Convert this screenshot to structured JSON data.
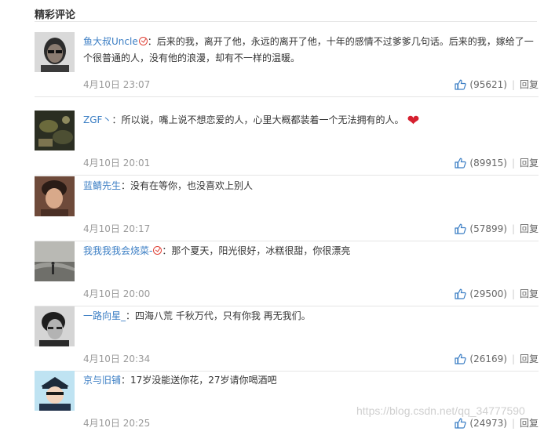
{
  "section": {
    "title": "精彩评论"
  },
  "comments": [
    {
      "user": "鱼大叔Uncle",
      "verified": true,
      "text": "：后来的我，离开了他，永远的离开了他，十年的感情不过爹爹几句话。后来的我，嫁给了一个很普通的人，没有他的浪漫，却有不一样的温暖。",
      "time": "4月10日 23:07",
      "likes": "(95621)",
      "reply": "回复"
    },
    {
      "user": "ZGF丶",
      "verified": false,
      "text": "：所以说，嘴上说不想恋爱的人，心里大概都装着一个无法拥有的人。",
      "emoji": "heart",
      "time": "4月10日 20:01",
      "likes": "(89915)",
      "reply": "回复"
    },
    {
      "user": "蓝鲭先生",
      "verified": false,
      "text": "：没有在等你，也没喜欢上别人",
      "time": "4月10日 20:17",
      "likes": "(57899)",
      "reply": "回复"
    },
    {
      "user": "我我我我会烧菜-",
      "verified": true,
      "text": "：那个夏天，阳光很好，冰糕很甜，你很漂亮",
      "time": "4月10日 20:00",
      "likes": "(29500)",
      "reply": "回复"
    },
    {
      "user": "一路向星_",
      "verified": false,
      "text": "：四海八荒 千秋万代，只有你我 再无我们。",
      "time": "4月10日 20:34",
      "likes": "(26169)",
      "reply": "回复"
    },
    {
      "user": "京与旧铺",
      "verified": false,
      "text": "：17岁没能送你花，27岁请你喝酒吧",
      "time": "4月10日 20:25",
      "likes": "(24973)",
      "reply": "回复"
    }
  ],
  "watermark": "https://blog.csdn.net/qq_34777590",
  "colors": {
    "username": "#3b7ec4",
    "meta": "#999999",
    "like_icon": "#3b7ec4",
    "divider": "#e5e5e5"
  }
}
